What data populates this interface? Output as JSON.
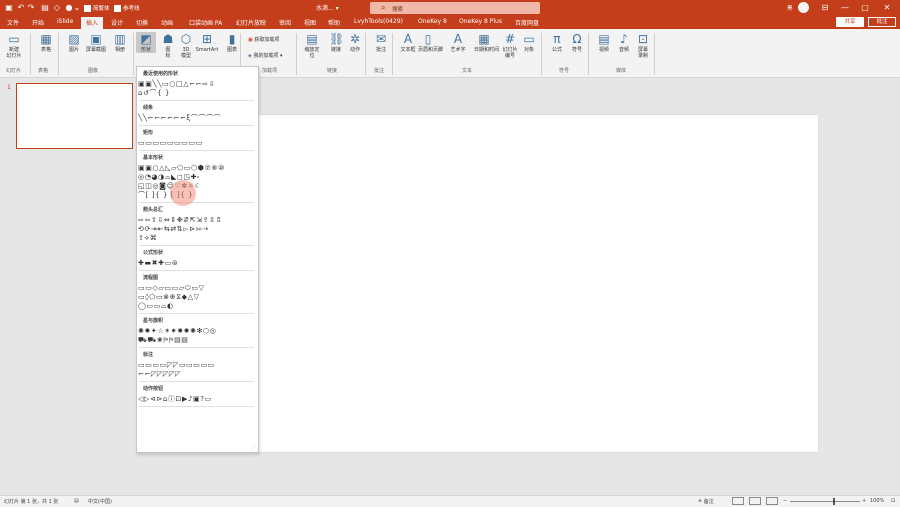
{
  "titlebar": {
    "quick_access": [
      {
        "icon": "save-icon",
        "glyph": "▣"
      },
      {
        "icon": "undo-icon",
        "glyph": "↶"
      },
      {
        "icon": "redo-icon",
        "glyph": "↷"
      },
      {
        "icon": "start-slideshow-icon",
        "glyph": "▤"
      },
      {
        "icon": "shape-icon",
        "glyph": "◇"
      },
      {
        "icon": "circle-record-icon",
        "glyph": "●"
      },
      {
        "icon": "more-icon",
        "glyph": "⌄"
      }
    ],
    "check1_label": "简繁体",
    "check2_label": "参考线",
    "doc_title": "水滴... ▾",
    "search_label": "搜索",
    "user_name": "黑",
    "window_controls": [
      "—",
      "▢",
      "✕"
    ]
  },
  "tabs": [
    "文件",
    "开始",
    "iSlide",
    "插入",
    "设计",
    "切换",
    "动画",
    "口袋动画 PA",
    "幻灯片放映",
    "审阅",
    "视图",
    "帮助",
    "LvyhTools(0429)",
    "OneKey 8",
    "OneKey 8 Plus",
    "百度网盘"
  ],
  "active_tab_index": 3,
  "share_label": "共享",
  "comment_label": "批注",
  "ribbon": {
    "buttons": [
      {
        "id": "new-slide",
        "label": "新建\n幻灯片",
        "icon": "new-slide-icon",
        "glyph": "▭"
      },
      {
        "id": "table",
        "label": "表格",
        "icon": "table-icon",
        "glyph": "▦"
      },
      {
        "id": "picture",
        "label": "图片",
        "icon": "picture-icon",
        "glyph": "▨"
      },
      {
        "id": "screenshot",
        "label": "屏幕截图",
        "icon": "screenshot-icon",
        "glyph": "▣"
      },
      {
        "id": "album",
        "label": "相册",
        "icon": "album-icon",
        "glyph": "▥"
      },
      {
        "id": "shapes",
        "label": "形状",
        "icon": "shapes-icon",
        "glyph": "◩"
      },
      {
        "id": "icons",
        "label": "图\n标",
        "icon": "icons-icon",
        "glyph": "☗"
      },
      {
        "id": "3d",
        "label": "3D\n模型",
        "icon": "3d-model-icon",
        "glyph": "⬡"
      },
      {
        "id": "smartart",
        "label": "SmartArt",
        "icon": "smartart-icon",
        "glyph": "⊞"
      },
      {
        "id": "chart",
        "label": "图表",
        "icon": "chart-icon",
        "glyph": "▮"
      },
      {
        "id": "zoom",
        "label": "缩放定\n位",
        "icon": "zoom-icon",
        "glyph": "▤"
      },
      {
        "id": "link",
        "label": "链接",
        "icon": "link-icon",
        "glyph": "⛓"
      },
      {
        "id": "action",
        "label": "动作",
        "icon": "action-icon",
        "glyph": "✲"
      },
      {
        "id": "comment",
        "label": "批注",
        "icon": "comment-icon",
        "glyph": "✉"
      },
      {
        "id": "textbox",
        "label": "文本框",
        "icon": "textbox-icon",
        "glyph": "A"
      },
      {
        "id": "header-footer",
        "label": "页眉和页脚",
        "icon": "header-footer-icon",
        "glyph": "▯"
      },
      {
        "id": "wordart",
        "label": "艺术字",
        "icon": "wordart-icon",
        "glyph": "A"
      },
      {
        "id": "datetime",
        "label": "日期和时间",
        "icon": "datetime-icon",
        "glyph": "▦"
      },
      {
        "id": "slide-number",
        "label": "幻灯片\n编号",
        "icon": "slide-number-icon",
        "glyph": "#"
      },
      {
        "id": "object",
        "label": "对象",
        "icon": "object-icon",
        "glyph": "▭"
      },
      {
        "id": "equation",
        "label": "公式",
        "icon": "equation-icon",
        "glyph": "π"
      },
      {
        "id": "symbol",
        "label": "符号",
        "icon": "symbol-icon",
        "glyph": "Ω"
      },
      {
        "id": "video",
        "label": "视频",
        "icon": "video-icon",
        "glyph": "▤"
      },
      {
        "id": "audio",
        "label": "音频",
        "icon": "audio-icon",
        "glyph": "♪"
      },
      {
        "id": "screen-record",
        "label": "屏幕\n录制",
        "icon": "screen-record-icon",
        "glyph": "⊡"
      }
    ],
    "addins": [
      "获取加载项",
      "我的加载项 ▾"
    ],
    "groups": [
      "幻灯片",
      "表格",
      "图像",
      "",
      "加载项",
      "链接",
      "批注",
      "文本",
      "符号",
      "媒体"
    ]
  },
  "slide_number": "1",
  "shapes_panel": {
    "sections": [
      {
        "title": "最近使用的形状",
        "rows": [
          "▣▣╲╲▭○□△⌐⌐⇨⇩",
          "⌂↺⌒{ }"
        ]
      },
      {
        "title": "线条",
        "rows": [
          "╲╲⌐⌐⌐⌐⌐⌐ξ⌒⌒⌒⌒"
        ]
      },
      {
        "title": "矩形",
        "rows": [
          "▭▭▭▭▭▭▭▭▭"
        ]
      },
      {
        "title": "基本形状",
        "rows": [
          "▣▣○△◺▱⬠▭⬡⬢⑦⑧⑩",
          "◎◔◕◑⌓◣◻◳✚⬞",
          "◱◫◎◙☺♡✲☼☾",
          "⌒[ ]{ } [ ]{ }"
        ]
      },
      {
        "title": "箭头总汇",
        "rows": [
          "⇨⇦⇧⇩⇔⇕✥⇵⇱⇲⇪⇫⇬",
          "⟲⟳⇥⇤⇆⇄⇅▻⊳⇰⇢",
          "⇧⟡⌘"
        ]
      },
      {
        "title": "公式形状",
        "rows": [
          "✚▬✖✚▭⊜"
        ]
      },
      {
        "title": "流程图",
        "rows": [
          "▭▭◇▱▭▭▱⬭▭▽",
          "▭◊⬠▭⊗⊕⧖◆△▽",
          "◯▭▭⌓◐"
        ]
      },
      {
        "title": "星与旗帜",
        "rows": [
          "✺✹✦☆✶✷✸✹✺✻⬡◎",
          "⛟⛟❀⛿⛿▤▤"
        ]
      },
      {
        "title": "标注",
        "rows": [
          "▭▭▭▭◸◸▭▭▭▭▭",
          "⌐⌐◸◸◸◸◸"
        ]
      },
      {
        "title": "动作按钮",
        "rows": [
          "◁▷⊲⊳⌂ⓘ⊡▶♪▣?▭"
        ]
      }
    ]
  },
  "statusbar": {
    "slide_info": "幻灯片 第 1 张，共 1 张",
    "language": "中文(中国)",
    "notes_label": "≙ 备注",
    "zoom_pct": "100%"
  },
  "colors": {
    "accent": "#c43e1c",
    "ribbon_bg": "#f3f3f3",
    "canvas_bg": "#e6e6e6"
  }
}
